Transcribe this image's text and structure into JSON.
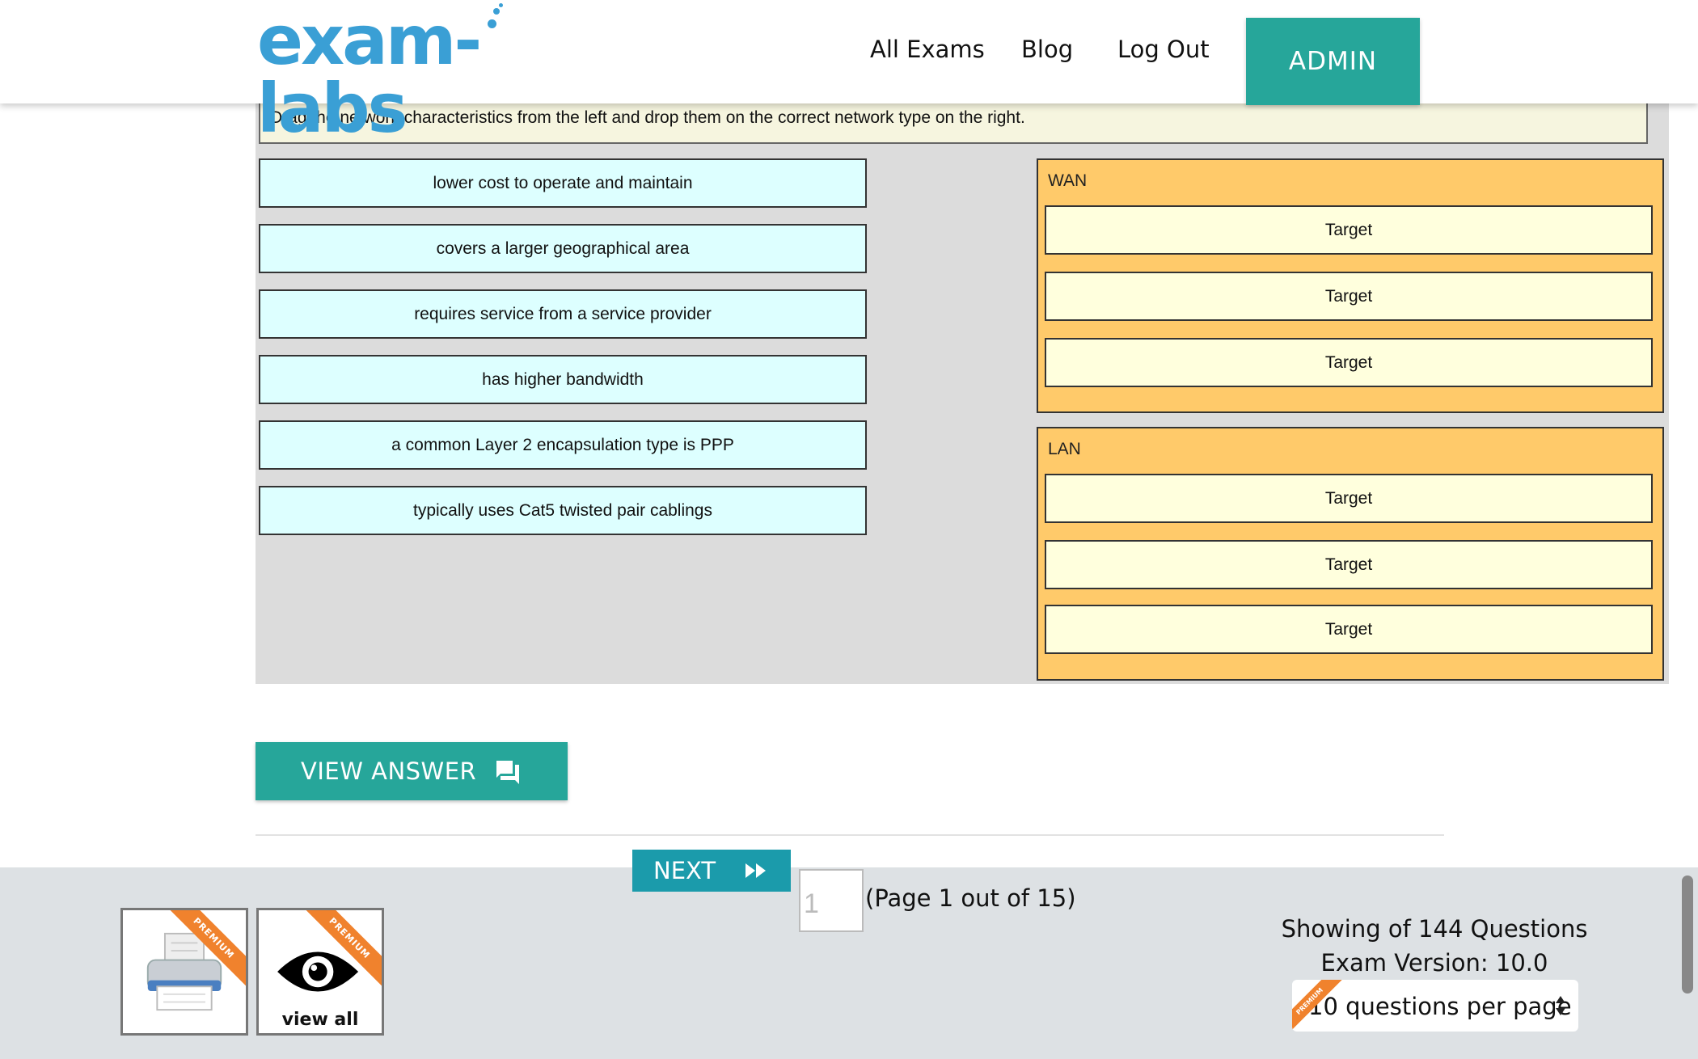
{
  "header": {
    "logo_text": "exam-labs",
    "nav": [
      "All Exams",
      "Blog",
      "Log Out"
    ],
    "admin_label": "ADMIN"
  },
  "question": {
    "instruction": "Drag the network characteristics from the left and drop them on the correct network type on the right.",
    "sources": [
      "lower cost to operate and maintain",
      "covers a larger geographical area",
      "requires service from a service provider",
      "has higher bandwidth",
      "a common Layer 2 encapsulation type is PPP",
      "typically uses Cat5 twisted pair cablings"
    ],
    "groups": [
      {
        "title": "WAN",
        "targets": [
          "Target",
          "Target",
          "Target"
        ]
      },
      {
        "title": "LAN",
        "targets": [
          "Target",
          "Target",
          "Target"
        ]
      }
    ]
  },
  "view_answer_label": "VIEW ANSWER",
  "footer": {
    "next_label": "NEXT",
    "page_input_value": "1",
    "page_text": "(Page 1 out of 15)",
    "premium_label": "PREMIUM",
    "view_all_label": "view all",
    "showing_text": "Showing of 144 Questions",
    "version_text": "Exam Version: 10.0",
    "per_page_selected": "10 questions per page"
  },
  "colors": {
    "teal": "#26a69a",
    "next_blue": "#1b9bab",
    "logo_blue": "#3a9fd5",
    "source_bg": "#ddffff",
    "group_bg": "#ffca6a",
    "target_bg": "#ffffdd",
    "ribbon_orange": "#f0822d"
  },
  "icons": {
    "view_answer": "chat-bubbles-icon",
    "next": "fast-forward-icon",
    "print": "printer-icon",
    "view_all": "eye-icon",
    "select": "select-arrows-icon"
  }
}
